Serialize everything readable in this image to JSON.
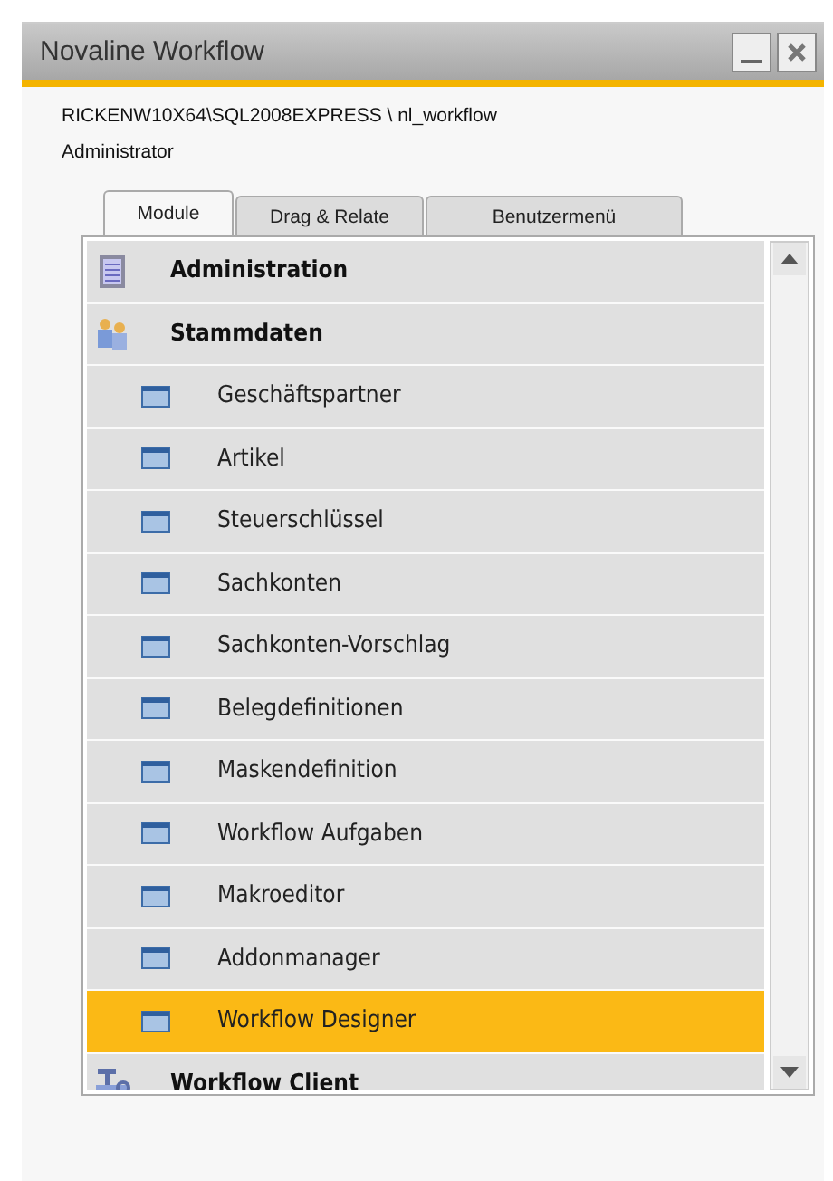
{
  "window": {
    "title": "Novaline Workflow"
  },
  "connection": "RICKENW10X64\\SQL2008EXPRESS  \\  nl_workflow",
  "user": "Administrator",
  "tabs": [
    {
      "label": "Module",
      "selected": true
    },
    {
      "label": "Drag & Relate",
      "selected": false
    },
    {
      "label": "Benutzermenü",
      "selected": false
    }
  ],
  "tree": [
    {
      "kind": "group",
      "label": "Administration",
      "selected": false
    },
    {
      "kind": "group",
      "label": "Stammdaten",
      "selected": false
    },
    {
      "kind": "item",
      "label": "Geschäftspartner",
      "selected": false
    },
    {
      "kind": "item",
      "label": "Artikel",
      "selected": false
    },
    {
      "kind": "item",
      "label": "Steuerschlüssel",
      "selected": false
    },
    {
      "kind": "item",
      "label": "Sachkonten",
      "selected": false
    },
    {
      "kind": "item",
      "label": "Sachkonten-Vorschlag",
      "selected": false
    },
    {
      "kind": "item",
      "label": "Belegdefinitionen",
      "selected": false
    },
    {
      "kind": "item",
      "label": "Maskendefinition",
      "selected": false
    },
    {
      "kind": "item",
      "label": "Workflow Aufgaben",
      "selected": false
    },
    {
      "kind": "item",
      "label": "Makroeditor",
      "selected": false
    },
    {
      "kind": "item",
      "label": "Addonmanager",
      "selected": false
    },
    {
      "kind": "item",
      "label": "Workflow Designer",
      "selected": true
    },
    {
      "kind": "group",
      "label": "Workflow Client",
      "selected": false
    }
  ]
}
